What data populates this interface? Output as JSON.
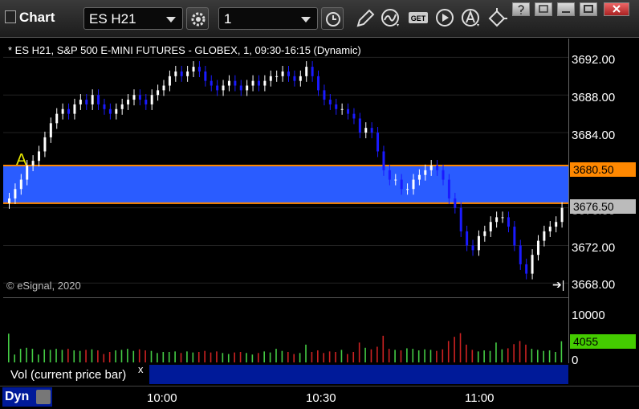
{
  "window": {
    "title": "Chart"
  },
  "toolbar": {
    "symbol": "ES H21",
    "interval": "1",
    "get_label": "GET"
  },
  "chart": {
    "title": "* ES H21, S&P 500 E-MINI FUTURES - GLOBEX, 1, 09:30-16:15 (Dynamic)",
    "watermark": "© eSignal, 2020",
    "marker": "A",
    "price_axis": [
      "3692.00",
      "3688.00",
      "3684.00",
      "3680.00",
      "3676.00",
      "3672.00",
      "3668.00"
    ],
    "tag_upper": "3680.50",
    "tag_lower": "3676.50",
    "colors": {
      "up": "#ffffff",
      "down": "#1a1aff",
      "band": "#2a5cff",
      "band_line": "#ff8800",
      "vol_up": "#44cc44",
      "vol_down": "#cc2222"
    }
  },
  "volume": {
    "label": "Vol (current price bar)",
    "close_glyph": "x",
    "axis": [
      "10000",
      "0"
    ],
    "current": "4055"
  },
  "time_axis": [
    "10:00",
    "10:30",
    "11:00"
  ],
  "status": {
    "mode": "Dyn"
  },
  "chart_data": {
    "type": "candlestick",
    "title": "* ES H21, S&P 500 E-MINI FUTURES - GLOBEX, 1, 09:30-16:15 (Dynamic)",
    "ylim": [
      3667,
      3694
    ],
    "x_ticks": [
      "10:00",
      "10:30",
      "11:00"
    ],
    "y_ticks": [
      3692,
      3688,
      3684,
      3680,
      3676,
      3672,
      3668
    ],
    "band": [
      3676.5,
      3680.5
    ],
    "closes": [
      3677,
      3678,
      3679,
      3680.5,
      3681,
      3682,
      3683.5,
      3685,
      3686,
      3686.5,
      3686,
      3687,
      3687.5,
      3687,
      3688,
      3687,
      3686.5,
      3686,
      3686.5,
      3687,
      3687.5,
      3688,
      3687.5,
      3687,
      3688,
      3688.5,
      3689,
      3690,
      3690.5,
      3690,
      3690.5,
      3691,
      3690.5,
      3689.5,
      3689,
      3688.5,
      3689,
      3689.5,
      3689,
      3688.5,
      3689,
      3689.5,
      3689,
      3689.5,
      3690,
      3690,
      3690.5,
      3690,
      3689.5,
      3690,
      3691,
      3690,
      3688.5,
      3687.5,
      3687,
      3686.5,
      3686.5,
      3686,
      3685.5,
      3684,
      3684.5,
      3684,
      3682,
      3680,
      3679,
      3679,
      3678,
      3678,
      3679,
      3679.5,
      3680,
      3680.5,
      3680,
      3679,
      3677,
      3676,
      3673.5,
      3672,
      3671.5,
      3673,
      3673.5,
      3674.5,
      3675,
      3675,
      3674,
      3672,
      3670,
      3669,
      3671,
      3672.5,
      3673.5,
      3674,
      3674.5,
      3676
    ],
    "volume": [
      5500,
      1500,
      2600,
      2800,
      2600,
      1500,
      2500,
      2400,
      2600,
      2400,
      2600,
      2300,
      2200,
      2400,
      2500,
      2300,
      1600,
      2000,
      2300,
      2400,
      2600,
      2200,
      2500,
      2300,
      2200,
      1800,
      2000,
      2000,
      2100,
      1800,
      2100,
      1900,
      2000,
      2200,
      1900,
      2100,
      1800,
      1600,
      1900,
      2000,
      1800,
      1500,
      1800,
      2100,
      1900,
      2600,
      2200,
      2000,
      1600,
      1800,
      3400,
      2000,
      2300,
      1800,
      2100,
      2000,
      2400,
      1600,
      2000,
      3800,
      2800,
      2500,
      3000,
      5100,
      2600,
      2400,
      2300,
      2700,
      2600,
      2300,
      2500,
      2400,
      2200,
      2500,
      4100,
      4900,
      5600,
      3400,
      2400,
      2100,
      2300,
      2200,
      3800,
      2500,
      2700,
      3500,
      4100,
      3400,
      2600,
      2400,
      2200,
      2300,
      2000,
      4055
    ],
    "vol_ylim": [
      0,
      12000
    ]
  }
}
